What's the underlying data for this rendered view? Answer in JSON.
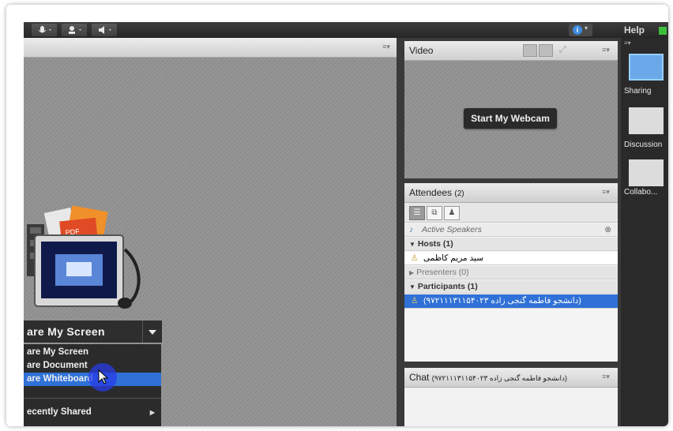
{
  "topbar": {
    "help": "Help",
    "tool_icons": [
      "microphone-icon",
      "camera-icon",
      "speaker-icon"
    ]
  },
  "share_pod": {
    "button_label": "are My Screen",
    "menu": [
      {
        "label": "are My Screen",
        "highlighted": false
      },
      {
        "label": "are Document",
        "highlighted": false
      },
      {
        "label": "are Whiteboard",
        "highlighted": true
      }
    ],
    "recent": "ecently Shared"
  },
  "video_pod": {
    "title": "Video",
    "webcam_button": "Start My Webcam"
  },
  "attendees_pod": {
    "title": "Attendees",
    "count": "(2)",
    "active_speakers": "Active Speakers",
    "hosts_header": "Hosts (1)",
    "host_name": "سید مریم کاظمی",
    "presenters_header": "Presenters (0)",
    "participants_header": "Participants (1)",
    "participant_name": "(دانشجو فاطمه گنجی زاده ۹۷۲۱۱۱۳۱۱۵۴۰۲۳)"
  },
  "chat_pod": {
    "title": "Chat",
    "recipient": "(دانشجو فاطمه گنجی زاده ۹۷۲۱۱۱۳۱۱۵۴۰۲۳)"
  },
  "layouts": [
    {
      "label": "Sharing",
      "selected": true
    },
    {
      "label": "Discussion",
      "selected": false
    },
    {
      "label": "Collabo...",
      "selected": false
    }
  ],
  "colors": {
    "accent": "#2f71d6",
    "toolbar_dark": "#2e2e2e",
    "pod_header": "#e4e4e4"
  }
}
